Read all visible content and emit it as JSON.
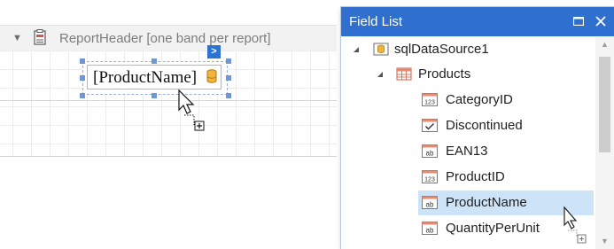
{
  "designer": {
    "band": {
      "expander_icon": "triangle-down-icon",
      "icon": "report-header-icon",
      "title": "ReportHeader [one band per report]"
    },
    "control": {
      "text": "[ProductName]",
      "icon": "database-icon",
      "smart_tag": ">"
    }
  },
  "field_list": {
    "title": "Field List",
    "maximize_icon": "maximize-icon",
    "close_icon": "close-icon",
    "tree": [
      {
        "label": "sqlDataSource1",
        "icon": "datasource-icon",
        "expander": "expanded-triangle-icon"
      },
      {
        "label": "Products",
        "icon": "table-icon",
        "expander": "expanded-triangle-icon"
      },
      {
        "label": "CategoryID",
        "icon": "number-field-icon",
        "badge": "123"
      },
      {
        "label": "Discontinued",
        "icon": "boolean-field-icon",
        "badge": ""
      },
      {
        "label": "EAN13",
        "icon": "string-field-icon",
        "badge": "ab"
      },
      {
        "label": "ProductID",
        "icon": "number-field-icon",
        "badge": "123"
      },
      {
        "label": "ProductName",
        "icon": "string-field-icon",
        "badge": "ab",
        "selected": true
      },
      {
        "label": "QuantityPerUnit",
        "icon": "string-field-icon",
        "badge": "ab"
      }
    ]
  },
  "colors": {
    "accent": "#2f6fcf",
    "selection": "#cde3f8",
    "handle": "#6f97d4"
  }
}
